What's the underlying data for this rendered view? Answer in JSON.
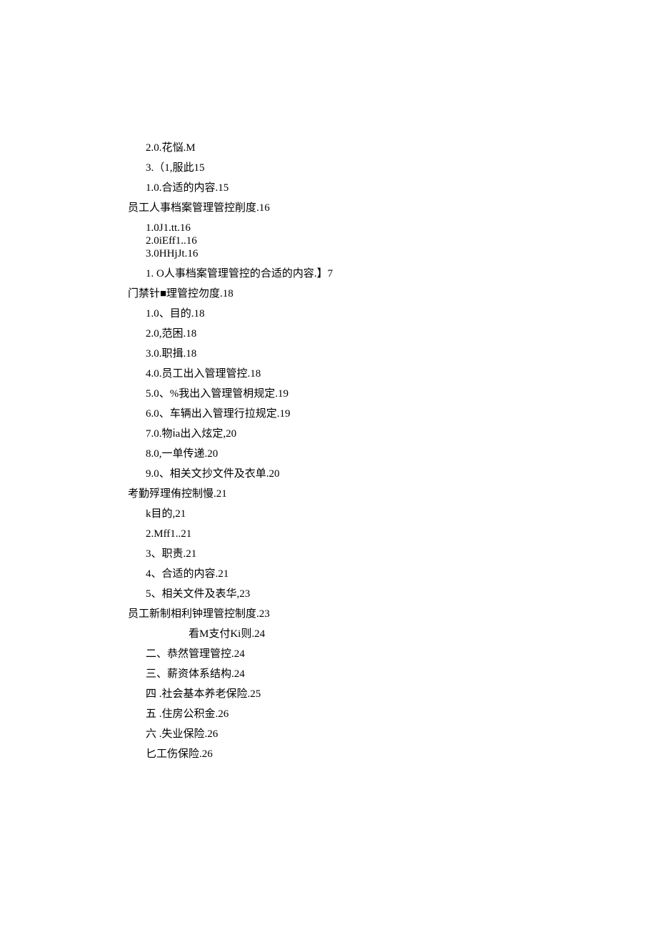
{
  "lines": [
    {
      "text": "2.0.花悩.M",
      "indent": 2,
      "tight": false
    },
    {
      "text": "3.（1,服此15",
      "indent": 2,
      "tight": false
    },
    {
      "text": "1.0.合适的内容.15",
      "indent": 2,
      "tight": false
    },
    {
      "text": "员工人事档案管理管控削度.16",
      "indent": 1,
      "tight": false
    },
    {
      "text": "1.0J1.tt.16",
      "indent": 2,
      "tight": true
    },
    {
      "text": "2.0iEff1..16",
      "indent": 2,
      "tight": true
    },
    {
      "text": "3.0HHjJt.16",
      "indent": 2,
      "tight": false
    },
    {
      "text": "1.  O人事档案管理管控的合适的内容.】7",
      "indent": 2,
      "tight": false
    },
    {
      "text": "门禁针■理管控勿度.18",
      "indent": 1,
      "tight": false
    },
    {
      "text": "1.0、目的.18",
      "indent": 2,
      "tight": false
    },
    {
      "text": "2.0,范困.18",
      "indent": 2,
      "tight": false
    },
    {
      "text": "3.0.职揖.18",
      "indent": 2,
      "tight": false
    },
    {
      "text": "4.0.员工出入管理管控.18",
      "indent": 2,
      "tight": false
    },
    {
      "text": "5.0、%我出入管理管枂规定.19",
      "indent": 2,
      "tight": false
    },
    {
      "text": "6.0、车辆出入管理行拉规定.19",
      "indent": 2,
      "tight": false
    },
    {
      "text": "7.0.物ⅰa出入炫定,20",
      "indent": 2,
      "tight": false
    },
    {
      "text": "8.0,一单传递.20",
      "indent": 2,
      "tight": false
    },
    {
      "text": "9.0、相关文抄文件及衣单.20",
      "indent": 2,
      "tight": false
    },
    {
      "text": "考勤殍理侑控制慢.21",
      "indent": 1,
      "tight": false
    },
    {
      "text": "k目的,21",
      "indent": 2,
      "tight": false
    },
    {
      "text": "2.Mff1..21",
      "indent": 2,
      "tight": false
    },
    {
      "text": "3、职责.21",
      "indent": 2,
      "tight": false
    },
    {
      "text": "4、合适的内容.21",
      "indent": 2,
      "tight": false
    },
    {
      "text": "5、相关文件及表华,23",
      "indent": 2,
      "tight": false
    },
    {
      "text": "员工新制相利钟理管控制度.23",
      "indent": 1,
      "tight": false
    },
    {
      "text": "看M支付Ki则.24",
      "indent": 3,
      "tight": false
    },
    {
      "text": "二、恭然管理管控.24",
      "indent": 2,
      "tight": false
    },
    {
      "text": "三、薪资体系结构.24",
      "indent": 2,
      "tight": false
    },
    {
      "text": "四    .社会基本养老保险.25",
      "indent": 2,
      "tight": false
    },
    {
      "text": "五    .住房公积金.26",
      "indent": 2,
      "tight": false
    },
    {
      "text": "六    .失业保险.26",
      "indent": 2,
      "tight": false
    },
    {
      "text": "匕工伤保险.26",
      "indent": 2,
      "tight": false
    }
  ]
}
